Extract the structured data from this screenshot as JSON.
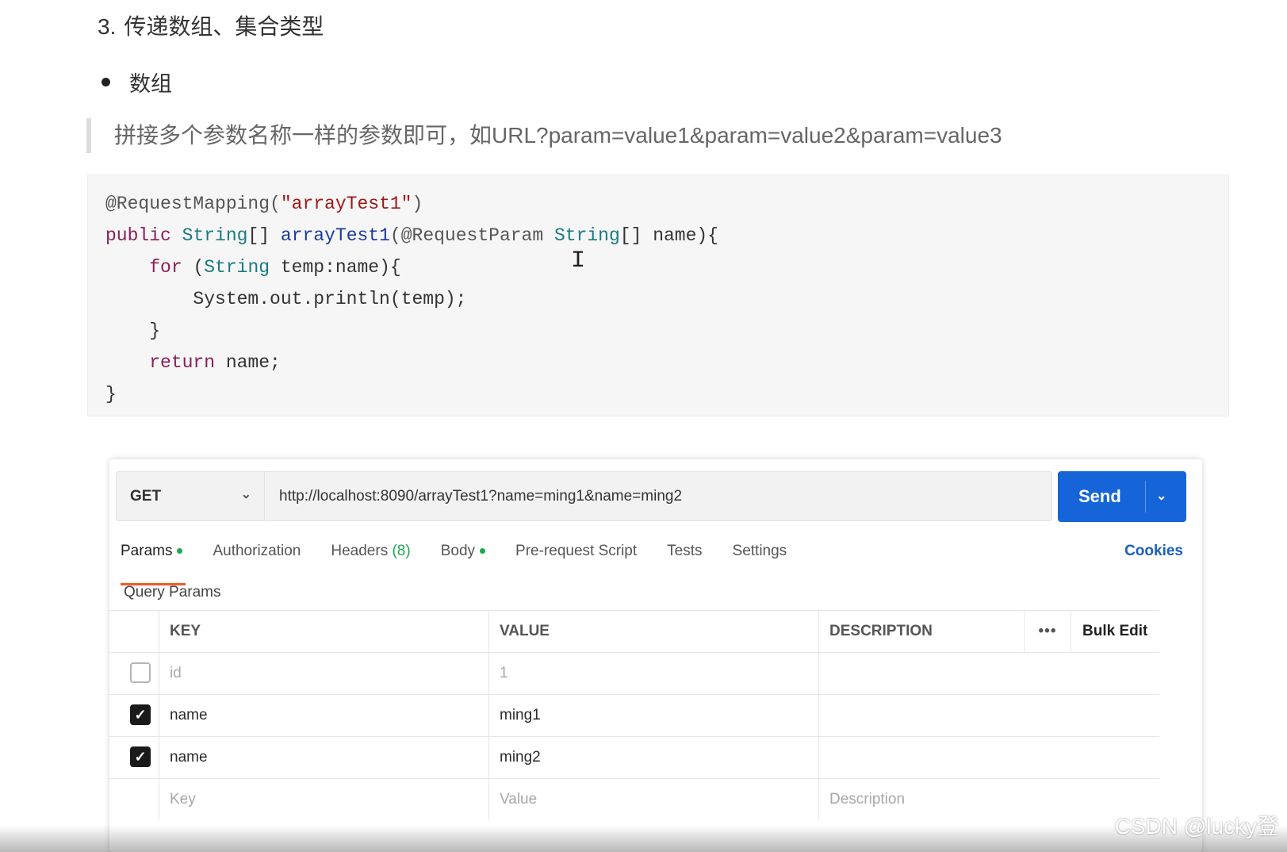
{
  "heading": {
    "number": "3.",
    "text": "传递数组、集合类型"
  },
  "bullet": {
    "text": "数组"
  },
  "quote": {
    "text": "拼接多个参数名称一样的参数即可，如URL?param=value1&param=value2&param=value3"
  },
  "code": {
    "l1_annotation": "@RequestMapping(",
    "l1_string": "\"arrayTest1\"",
    "l1_close": ")",
    "l2_public": "public",
    "l2_type": "String",
    "l2_brackets": "[] ",
    "l2_method": "arrayTest1",
    "l2_param_ann": "(@RequestParam ",
    "l2_type2": "String",
    "l2_rest": "[] name){",
    "l3_for": "for",
    "l3_open": " (",
    "l3_type": "String",
    "l3_rest": " temp:name){",
    "l4": "System.out.println(temp);",
    "l5": "}",
    "l6_return": "return",
    "l6_rest": " name;",
    "l7": "}"
  },
  "request": {
    "method": "GET",
    "url": "http://localhost:8090/arrayTest1?name=ming1&name=ming2",
    "send_label": "Send"
  },
  "tabs": {
    "params": "Params",
    "authorization": "Authorization",
    "headers": "Headers",
    "headers_count": "(8)",
    "body": "Body",
    "prerequest": "Pre-request Script",
    "tests": "Tests",
    "settings": "Settings",
    "cookies": "Cookies"
  },
  "query_params": {
    "title": "Query Params",
    "columns": {
      "key": "KEY",
      "value": "VALUE",
      "description": "DESCRIPTION",
      "more": "•••",
      "bulk_edit": "Bulk Edit"
    },
    "rows": [
      {
        "checked": false,
        "key": "id",
        "value": "1",
        "description": ""
      },
      {
        "checked": true,
        "key": "name",
        "value": "ming1",
        "description": ""
      },
      {
        "checked": true,
        "key": "name",
        "value": "ming2",
        "description": ""
      }
    ],
    "placeholder": {
      "key": "Key",
      "value": "Value",
      "description": "Description"
    }
  },
  "watermark": "CSDN @lucky登",
  "colors": {
    "send_button": "#1565d8",
    "active_tab_underline": "#f05a28",
    "status_dot": "#1ba94c",
    "cookies_link": "#1b5fbf"
  }
}
